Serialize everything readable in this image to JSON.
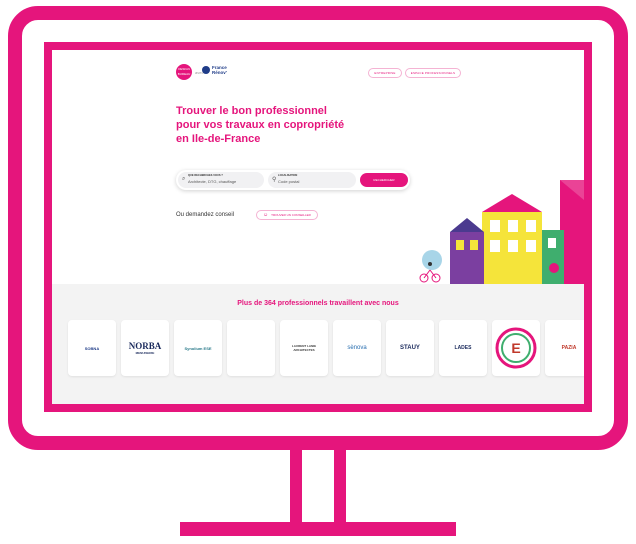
{
  "header": {
    "badge_lines": [
      "DESIGN",
      "BUREAU"
    ],
    "separator": "avec",
    "partner_logo": [
      "France",
      "Rénov'"
    ],
    "btn_companies": "ENTREPRISE",
    "btn_pro_space": "ESPACE PROFESSIONNELS"
  },
  "hero": {
    "title_lines": [
      "Trouver le bon professionnel",
      "pour vos travaux en copropriété",
      "en Ile-de-France"
    ]
  },
  "search": {
    "what_label": "QUE RECHERCHEZ-VOUS ?",
    "what_placeholder": "Architecte, DTG, chauffage",
    "where_label": "LOCALISATION",
    "where_placeholder": "Code postal",
    "button": "RECHERCHER",
    "search_icon": "search-icon",
    "pin_icon": "location-pin-icon"
  },
  "advice": {
    "text": "Ou demandez conseil",
    "button": "TROUVER UN CONSEILLER",
    "icon": "person-icon"
  },
  "professionals": {
    "title": "Plus de 364 professionnels travaillent avec nous",
    "logos": [
      {
        "name": "SOBNA"
      },
      {
        "name": "NORBA",
        "sub": "MENUISERIE"
      },
      {
        "name": "Synolium ESE"
      },
      {
        "name": ""
      },
      {
        "name": "LAURENT LANIE",
        "sub": "ARCHITECTES"
      },
      {
        "name": "sènova"
      },
      {
        "name": "STAUY"
      },
      {
        "name": "LADES"
      },
      {
        "name": "E"
      },
      {
        "name": "PAZIA"
      }
    ]
  },
  "colors": {
    "brand": "#e5157c",
    "navy": "#1f3c88",
    "band": "#f3f3f3"
  }
}
